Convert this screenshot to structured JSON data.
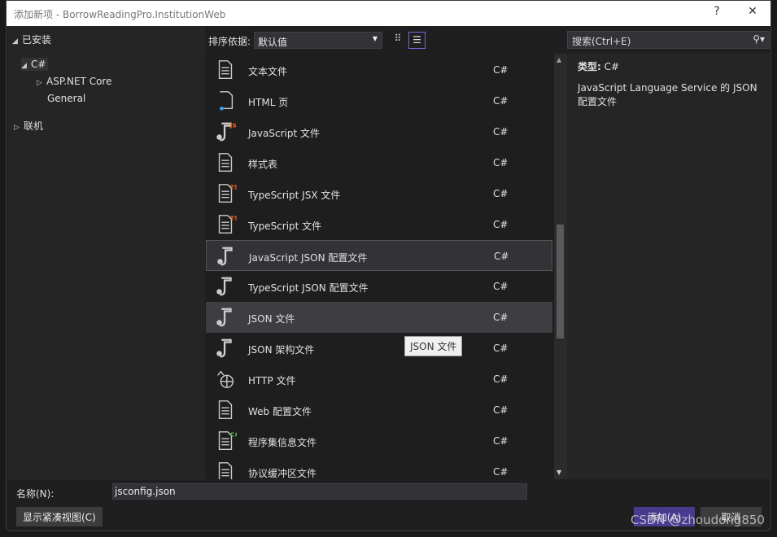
{
  "window": {
    "title": "添加新项 - BorrowReadingPro.InstitutionWeb",
    "help": "?",
    "close": "✕"
  },
  "tree": {
    "installed": "已安装",
    "csharp": "C#",
    "aspnet": "ASP.NET Core",
    "general": "General",
    "online": "联机"
  },
  "sort": {
    "label": "排序依据:",
    "value": "默认值"
  },
  "search": {
    "placeholder": "搜索(Ctrl+E)"
  },
  "items": [
    {
      "name": "文本文件",
      "lang": "C#",
      "icon": "text-file"
    },
    {
      "name": "HTML 页",
      "lang": "C#",
      "icon": "html"
    },
    {
      "name": "JavaScript 文件",
      "lang": "C#",
      "icon": "js",
      "badge": "JS"
    },
    {
      "name": "样式表",
      "lang": "C#",
      "icon": "css"
    },
    {
      "name": "TypeScript JSX 文件",
      "lang": "C#",
      "icon": "tsx",
      "badge": "TS"
    },
    {
      "name": "TypeScript 文件",
      "lang": "C#",
      "icon": "ts",
      "badge": "TS"
    },
    {
      "name": "JavaScript JSON 配置文件",
      "lang": "C#",
      "icon": "json"
    },
    {
      "name": "TypeScript JSON 配置文件",
      "lang": "C#",
      "icon": "json"
    },
    {
      "name": "JSON 文件",
      "lang": "C#",
      "icon": "json"
    },
    {
      "name": "JSON 架构文件",
      "lang": "C#",
      "icon": "json"
    },
    {
      "name": "HTTP 文件",
      "lang": "C#",
      "icon": "http"
    },
    {
      "name": "Web 配置文件",
      "lang": "C#",
      "icon": "web-config"
    },
    {
      "name": "程序集信息文件",
      "lang": "C#",
      "icon": "assembly",
      "badge": "C#"
    },
    {
      "name": "协议缓冲区文件",
      "lang": "C#",
      "icon": "protobuf"
    }
  ],
  "details": {
    "type_label": "类型:",
    "type_value": "C#",
    "description": "JavaScript Language Service 的 JSON 配置文件"
  },
  "tooltip": "JSON 文件",
  "name_field": {
    "label": "名称(N):",
    "value": "jsconfig.json"
  },
  "buttons": {
    "compact": "显示紧凑视图(C)",
    "add": "添加(A)",
    "cancel": "取消"
  },
  "watermark": "CSDN @zhoudong850",
  "colors": {
    "accent": "#5a3fa0",
    "badge": "#f26522"
  }
}
